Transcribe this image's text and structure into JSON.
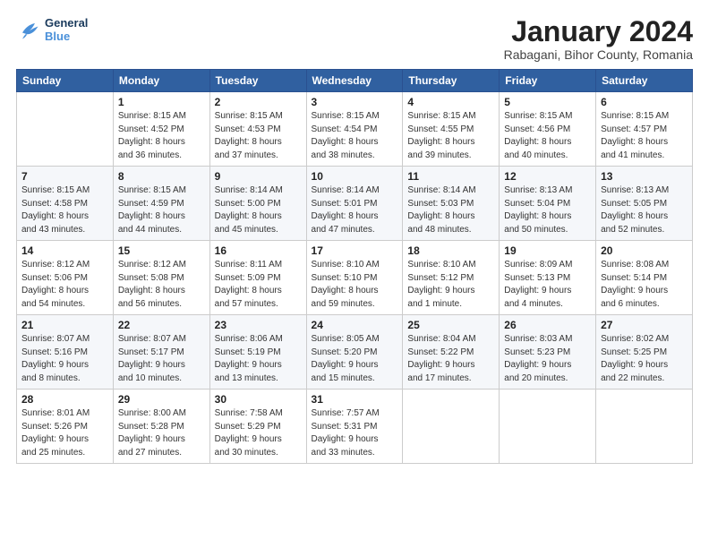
{
  "logo": {
    "line1": "General",
    "line2": "Blue"
  },
  "title": "January 2024",
  "subtitle": "Rabagani, Bihor County, Romania",
  "weekdays": [
    "Sunday",
    "Monday",
    "Tuesday",
    "Wednesday",
    "Thursday",
    "Friday",
    "Saturday"
  ],
  "weeks": [
    [
      {
        "day": "",
        "info": ""
      },
      {
        "day": "1",
        "info": "Sunrise: 8:15 AM\nSunset: 4:52 PM\nDaylight: 8 hours\nand 36 minutes."
      },
      {
        "day": "2",
        "info": "Sunrise: 8:15 AM\nSunset: 4:53 PM\nDaylight: 8 hours\nand 37 minutes."
      },
      {
        "day": "3",
        "info": "Sunrise: 8:15 AM\nSunset: 4:54 PM\nDaylight: 8 hours\nand 38 minutes."
      },
      {
        "day": "4",
        "info": "Sunrise: 8:15 AM\nSunset: 4:55 PM\nDaylight: 8 hours\nand 39 minutes."
      },
      {
        "day": "5",
        "info": "Sunrise: 8:15 AM\nSunset: 4:56 PM\nDaylight: 8 hours\nand 40 minutes."
      },
      {
        "day": "6",
        "info": "Sunrise: 8:15 AM\nSunset: 4:57 PM\nDaylight: 8 hours\nand 41 minutes."
      }
    ],
    [
      {
        "day": "7",
        "info": "Sunrise: 8:15 AM\nSunset: 4:58 PM\nDaylight: 8 hours\nand 43 minutes."
      },
      {
        "day": "8",
        "info": "Sunrise: 8:15 AM\nSunset: 4:59 PM\nDaylight: 8 hours\nand 44 minutes."
      },
      {
        "day": "9",
        "info": "Sunrise: 8:14 AM\nSunset: 5:00 PM\nDaylight: 8 hours\nand 45 minutes."
      },
      {
        "day": "10",
        "info": "Sunrise: 8:14 AM\nSunset: 5:01 PM\nDaylight: 8 hours\nand 47 minutes."
      },
      {
        "day": "11",
        "info": "Sunrise: 8:14 AM\nSunset: 5:03 PM\nDaylight: 8 hours\nand 48 minutes."
      },
      {
        "day": "12",
        "info": "Sunrise: 8:13 AM\nSunset: 5:04 PM\nDaylight: 8 hours\nand 50 minutes."
      },
      {
        "day": "13",
        "info": "Sunrise: 8:13 AM\nSunset: 5:05 PM\nDaylight: 8 hours\nand 52 minutes."
      }
    ],
    [
      {
        "day": "14",
        "info": "Sunrise: 8:12 AM\nSunset: 5:06 PM\nDaylight: 8 hours\nand 54 minutes."
      },
      {
        "day": "15",
        "info": "Sunrise: 8:12 AM\nSunset: 5:08 PM\nDaylight: 8 hours\nand 56 minutes."
      },
      {
        "day": "16",
        "info": "Sunrise: 8:11 AM\nSunset: 5:09 PM\nDaylight: 8 hours\nand 57 minutes."
      },
      {
        "day": "17",
        "info": "Sunrise: 8:10 AM\nSunset: 5:10 PM\nDaylight: 8 hours\nand 59 minutes."
      },
      {
        "day": "18",
        "info": "Sunrise: 8:10 AM\nSunset: 5:12 PM\nDaylight: 9 hours\nand 1 minute."
      },
      {
        "day": "19",
        "info": "Sunrise: 8:09 AM\nSunset: 5:13 PM\nDaylight: 9 hours\nand 4 minutes."
      },
      {
        "day": "20",
        "info": "Sunrise: 8:08 AM\nSunset: 5:14 PM\nDaylight: 9 hours\nand 6 minutes."
      }
    ],
    [
      {
        "day": "21",
        "info": "Sunrise: 8:07 AM\nSunset: 5:16 PM\nDaylight: 9 hours\nand 8 minutes."
      },
      {
        "day": "22",
        "info": "Sunrise: 8:07 AM\nSunset: 5:17 PM\nDaylight: 9 hours\nand 10 minutes."
      },
      {
        "day": "23",
        "info": "Sunrise: 8:06 AM\nSunset: 5:19 PM\nDaylight: 9 hours\nand 13 minutes."
      },
      {
        "day": "24",
        "info": "Sunrise: 8:05 AM\nSunset: 5:20 PM\nDaylight: 9 hours\nand 15 minutes."
      },
      {
        "day": "25",
        "info": "Sunrise: 8:04 AM\nSunset: 5:22 PM\nDaylight: 9 hours\nand 17 minutes."
      },
      {
        "day": "26",
        "info": "Sunrise: 8:03 AM\nSunset: 5:23 PM\nDaylight: 9 hours\nand 20 minutes."
      },
      {
        "day": "27",
        "info": "Sunrise: 8:02 AM\nSunset: 5:25 PM\nDaylight: 9 hours\nand 22 minutes."
      }
    ],
    [
      {
        "day": "28",
        "info": "Sunrise: 8:01 AM\nSunset: 5:26 PM\nDaylight: 9 hours\nand 25 minutes."
      },
      {
        "day": "29",
        "info": "Sunrise: 8:00 AM\nSunset: 5:28 PM\nDaylight: 9 hours\nand 27 minutes."
      },
      {
        "day": "30",
        "info": "Sunrise: 7:58 AM\nSunset: 5:29 PM\nDaylight: 9 hours\nand 30 minutes."
      },
      {
        "day": "31",
        "info": "Sunrise: 7:57 AM\nSunset: 5:31 PM\nDaylight: 9 hours\nand 33 minutes."
      },
      {
        "day": "",
        "info": ""
      },
      {
        "day": "",
        "info": ""
      },
      {
        "day": "",
        "info": ""
      }
    ]
  ]
}
